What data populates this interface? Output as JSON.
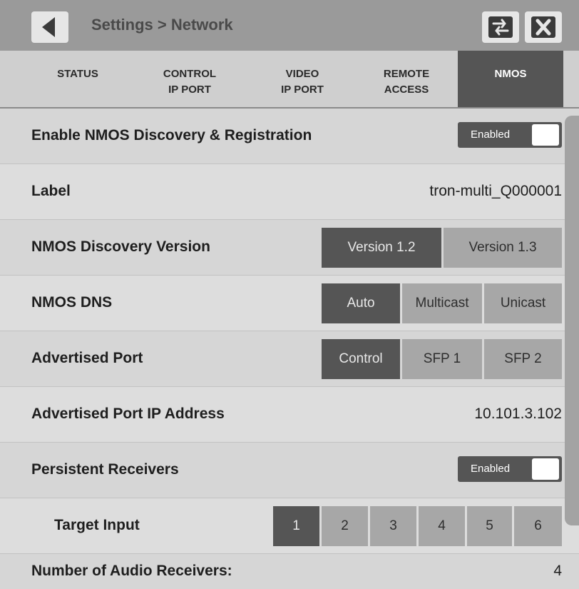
{
  "header": {
    "breadcrumb": "Settings > Network",
    "back_icon": "back-arrow-icon",
    "swap_icon": "swap-arrows-icon",
    "close_icon": "close-icon"
  },
  "tabs": [
    {
      "line1": "STATUS",
      "line2": ""
    },
    {
      "line1": "CONTROL",
      "line2": "IP PORT"
    },
    {
      "line1": "VIDEO",
      "line2": "IP PORT"
    },
    {
      "line1": "REMOTE",
      "line2": "ACCESS"
    },
    {
      "line1": "NMOS",
      "line2": ""
    }
  ],
  "active_tab": "NMOS",
  "settings": {
    "enable_discovery": {
      "label": "Enable NMOS Discovery & Registration",
      "state": "Enabled"
    },
    "label_field": {
      "label": "Label",
      "value": "tron-multi_Q000001"
    },
    "discovery_version": {
      "label": "NMOS Discovery Version",
      "options": [
        "Version 1.2",
        "Version 1.3"
      ],
      "selected": "Version 1.2"
    },
    "dns": {
      "label": "NMOS DNS",
      "options": [
        "Auto",
        "Multicast",
        "Unicast"
      ],
      "selected": "Auto"
    },
    "advertised_port": {
      "label": "Advertised Port",
      "options": [
        "Control",
        "SFP 1",
        "SFP 2"
      ],
      "selected": "Control"
    },
    "advertised_ip": {
      "label": "Advertised Port IP Address",
      "value": "10.101.3.102"
    },
    "persistent_receivers": {
      "label": "Persistent Receivers",
      "state": "Enabled"
    },
    "target_input": {
      "label": "Target Input",
      "options": [
        "1",
        "2",
        "3",
        "4",
        "5",
        "6"
      ],
      "selected": "1"
    },
    "audio_receivers": {
      "label": "Number of Audio Receivers:",
      "value": "4"
    }
  },
  "colors": {
    "title_bar": "#9a9a9a",
    "active": "#555555",
    "inactive_segment": "#a7a7a7",
    "background": "#d4d4d4"
  }
}
